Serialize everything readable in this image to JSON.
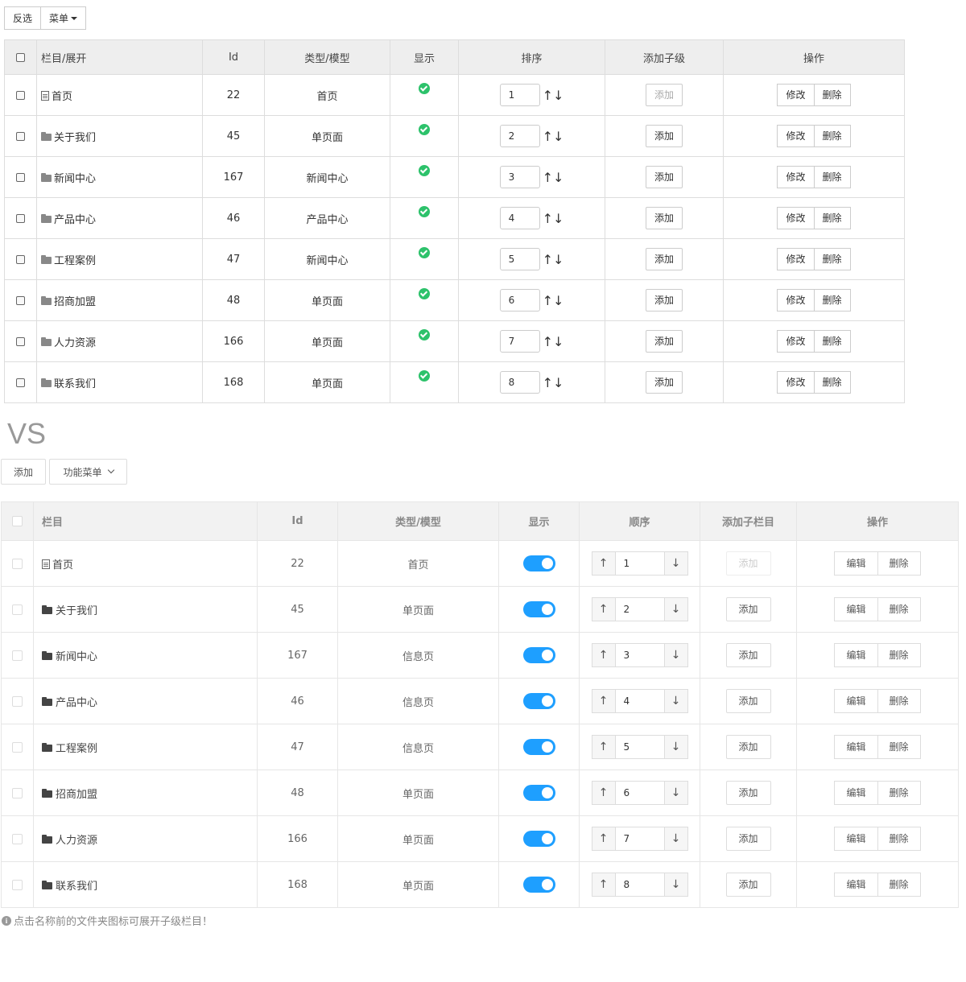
{
  "old": {
    "toolbar": {
      "invert_label": "反选",
      "menu_label": "菜单"
    },
    "headers": {
      "name": "栏目/展开",
      "id": "Id",
      "type": "类型/模型",
      "show": "显示",
      "sort": "排序",
      "add_child": "添加子级",
      "ops": "操作"
    },
    "add_label": "添加",
    "edit_label": "修改",
    "delete_label": "删除",
    "sort_arrows": "↑↓",
    "rows": [
      {
        "name": "首页",
        "id": "22",
        "type": "首页",
        "sort": "1",
        "icon": "file-icon",
        "add_disabled": true
      },
      {
        "name": "关于我们",
        "id": "45",
        "type": "单页面",
        "sort": "2",
        "icon": "folder-icon"
      },
      {
        "name": "新闻中心",
        "id": "167",
        "type": "新闻中心",
        "sort": "3",
        "icon": "folder-icon"
      },
      {
        "name": "产品中心",
        "id": "46",
        "type": "产品中心",
        "sort": "4",
        "icon": "folder-icon"
      },
      {
        "name": "工程案例",
        "id": "47",
        "type": "新闻中心",
        "sort": "5",
        "icon": "folder-icon"
      },
      {
        "name": "招商加盟",
        "id": "48",
        "type": "单页面",
        "sort": "6",
        "icon": "folder-icon"
      },
      {
        "name": "人力资源",
        "id": "166",
        "type": "单页面",
        "sort": "7",
        "icon": "folder-icon"
      },
      {
        "name": "联系我们",
        "id": "168",
        "type": "单页面",
        "sort": "8",
        "icon": "folder-icon"
      }
    ]
  },
  "vs_label": "VS",
  "new": {
    "toolbar": {
      "add_label": "添加",
      "menu_label": "功能菜单"
    },
    "headers": {
      "name": "栏目",
      "id": "Id",
      "type": "类型/模型",
      "show": "显示",
      "order": "顺序",
      "add_child": "添加子栏目",
      "ops": "操作"
    },
    "add_label": "添加",
    "edit_label": "编辑",
    "delete_label": "删除",
    "up_arrow": "↑",
    "down_arrow": "↓",
    "rows": [
      {
        "name": "首页",
        "id": "22",
        "type": "首页",
        "order": "1",
        "icon": "file-icon",
        "add_disabled": true,
        "shown": true
      },
      {
        "name": "关于我们",
        "id": "45",
        "type": "单页面",
        "order": "2",
        "icon": "folder-icon",
        "shown": true
      },
      {
        "name": "新闻中心",
        "id": "167",
        "type": "信息页",
        "order": "3",
        "icon": "folder-icon",
        "shown": true
      },
      {
        "name": "产品中心",
        "id": "46",
        "type": "信息页",
        "order": "4",
        "icon": "folder-icon",
        "shown": true
      },
      {
        "name": "工程案例",
        "id": "47",
        "type": "信息页",
        "order": "5",
        "icon": "folder-icon",
        "shown": true
      },
      {
        "name": "招商加盟",
        "id": "48",
        "type": "单页面",
        "order": "6",
        "icon": "folder-icon",
        "shown": true
      },
      {
        "name": "人力资源",
        "id": "166",
        "type": "单页面",
        "order": "7",
        "icon": "folder-icon",
        "shown": true
      },
      {
        "name": "联系我们",
        "id": "168",
        "type": "单页面",
        "order": "8",
        "icon": "folder-icon",
        "shown": true
      }
    ],
    "tip": "点击名称前的文件夹图标可展开子级栏目！"
  },
  "colors": {
    "check_green": "#2dc26b",
    "switch_blue": "#1e9fff"
  }
}
